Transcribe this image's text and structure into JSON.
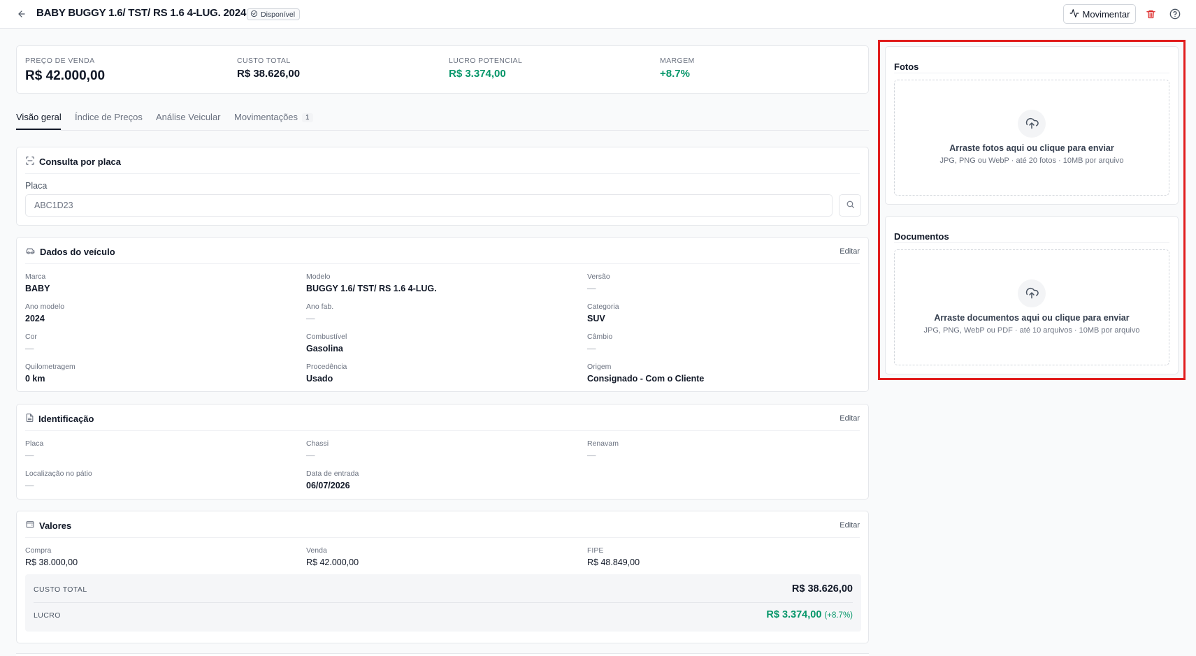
{
  "header": {
    "title": "BABY BUGGY 1.6/ TST/ RS 1.6 4-LUG. 2024",
    "status_badge": "Disponível",
    "movimentar_label": "Movimentar"
  },
  "stats": [
    {
      "label": "PREÇO DE VENDA",
      "value": "R$ 42.000,00"
    },
    {
      "label": "CUSTO TOTAL",
      "value": "R$ 38.626,00"
    },
    {
      "label": "LUCRO POTENCIAL",
      "value": "R$ 3.374,00"
    },
    {
      "label": "MARGEM",
      "value": "+8.7%"
    }
  ],
  "tabs": [
    {
      "label": "Visão geral"
    },
    {
      "label": "Índice de Preços"
    },
    {
      "label": "Análise Veicular"
    },
    {
      "label": "Movimentações",
      "count": "1"
    }
  ],
  "consulta": {
    "title": "Consulta por placa",
    "field_label": "Placa",
    "placeholder": "ABC1D23"
  },
  "dados": {
    "title": "Dados do veículo",
    "edit_label": "Editar",
    "fields": [
      {
        "label": "Marca",
        "value": "BABY"
      },
      {
        "label": "Modelo",
        "value": "BUGGY 1.6/ TST/ RS 1.6 4-LUG."
      },
      {
        "label": "Versão",
        "value": "—"
      },
      {
        "label": "Ano modelo",
        "value": "2024"
      },
      {
        "label": "Ano fab.",
        "value": "—"
      },
      {
        "label": "Categoria",
        "value": "SUV"
      },
      {
        "label": "Cor",
        "value": "—"
      },
      {
        "label": "Combustível",
        "value": "Gasolina"
      },
      {
        "label": "Câmbio",
        "value": "—"
      },
      {
        "label": "Quilometragem",
        "value": "0 km"
      },
      {
        "label": "Procedência",
        "value": "Usado"
      },
      {
        "label": "Origem",
        "value": "Consignado - Com o Cliente"
      }
    ]
  },
  "identificacao": {
    "title": "Identificação",
    "edit_label": "Editar",
    "fields": [
      {
        "label": "Placa",
        "value": "—"
      },
      {
        "label": "Chassi",
        "value": "—"
      },
      {
        "label": "Renavam",
        "value": "—"
      },
      {
        "label": "Localização no pátio",
        "value": "—"
      },
      {
        "label": "Data de entrada",
        "value": "06/07/2026"
      }
    ]
  },
  "valores": {
    "title": "Valores",
    "edit_label": "Editar",
    "fields": [
      {
        "label": "Compra",
        "value": "R$ 38.000,00"
      },
      {
        "label": "Venda",
        "value": "R$ 42.000,00"
      },
      {
        "label": "FIPE",
        "value": "R$ 48.849,00"
      }
    ],
    "custo_total_label": "CUSTO TOTAL",
    "custo_total_value": "R$ 38.626,00",
    "lucro_label": "LUCRO",
    "lucro_value": "R$ 3.374,00",
    "lucro_pct": "(+8.7%)"
  },
  "fotos": {
    "title": "Fotos",
    "drop_text": "Arraste fotos aqui ou clique para enviar",
    "drop_hint": "JPG, PNG ou WebP · até 20 fotos · 10MB por arquivo"
  },
  "documentos": {
    "title": "Documentos",
    "drop_text": "Arraste documentos aqui ou clique para enviar",
    "drop_hint": "JPG, PNG, WebP ou PDF · até 10 arquivos · 10MB por arquivo"
  },
  "colors": {
    "accent_green": "#059669",
    "delete_red": "#dc2626",
    "highlight_red": "#e11d1d"
  }
}
